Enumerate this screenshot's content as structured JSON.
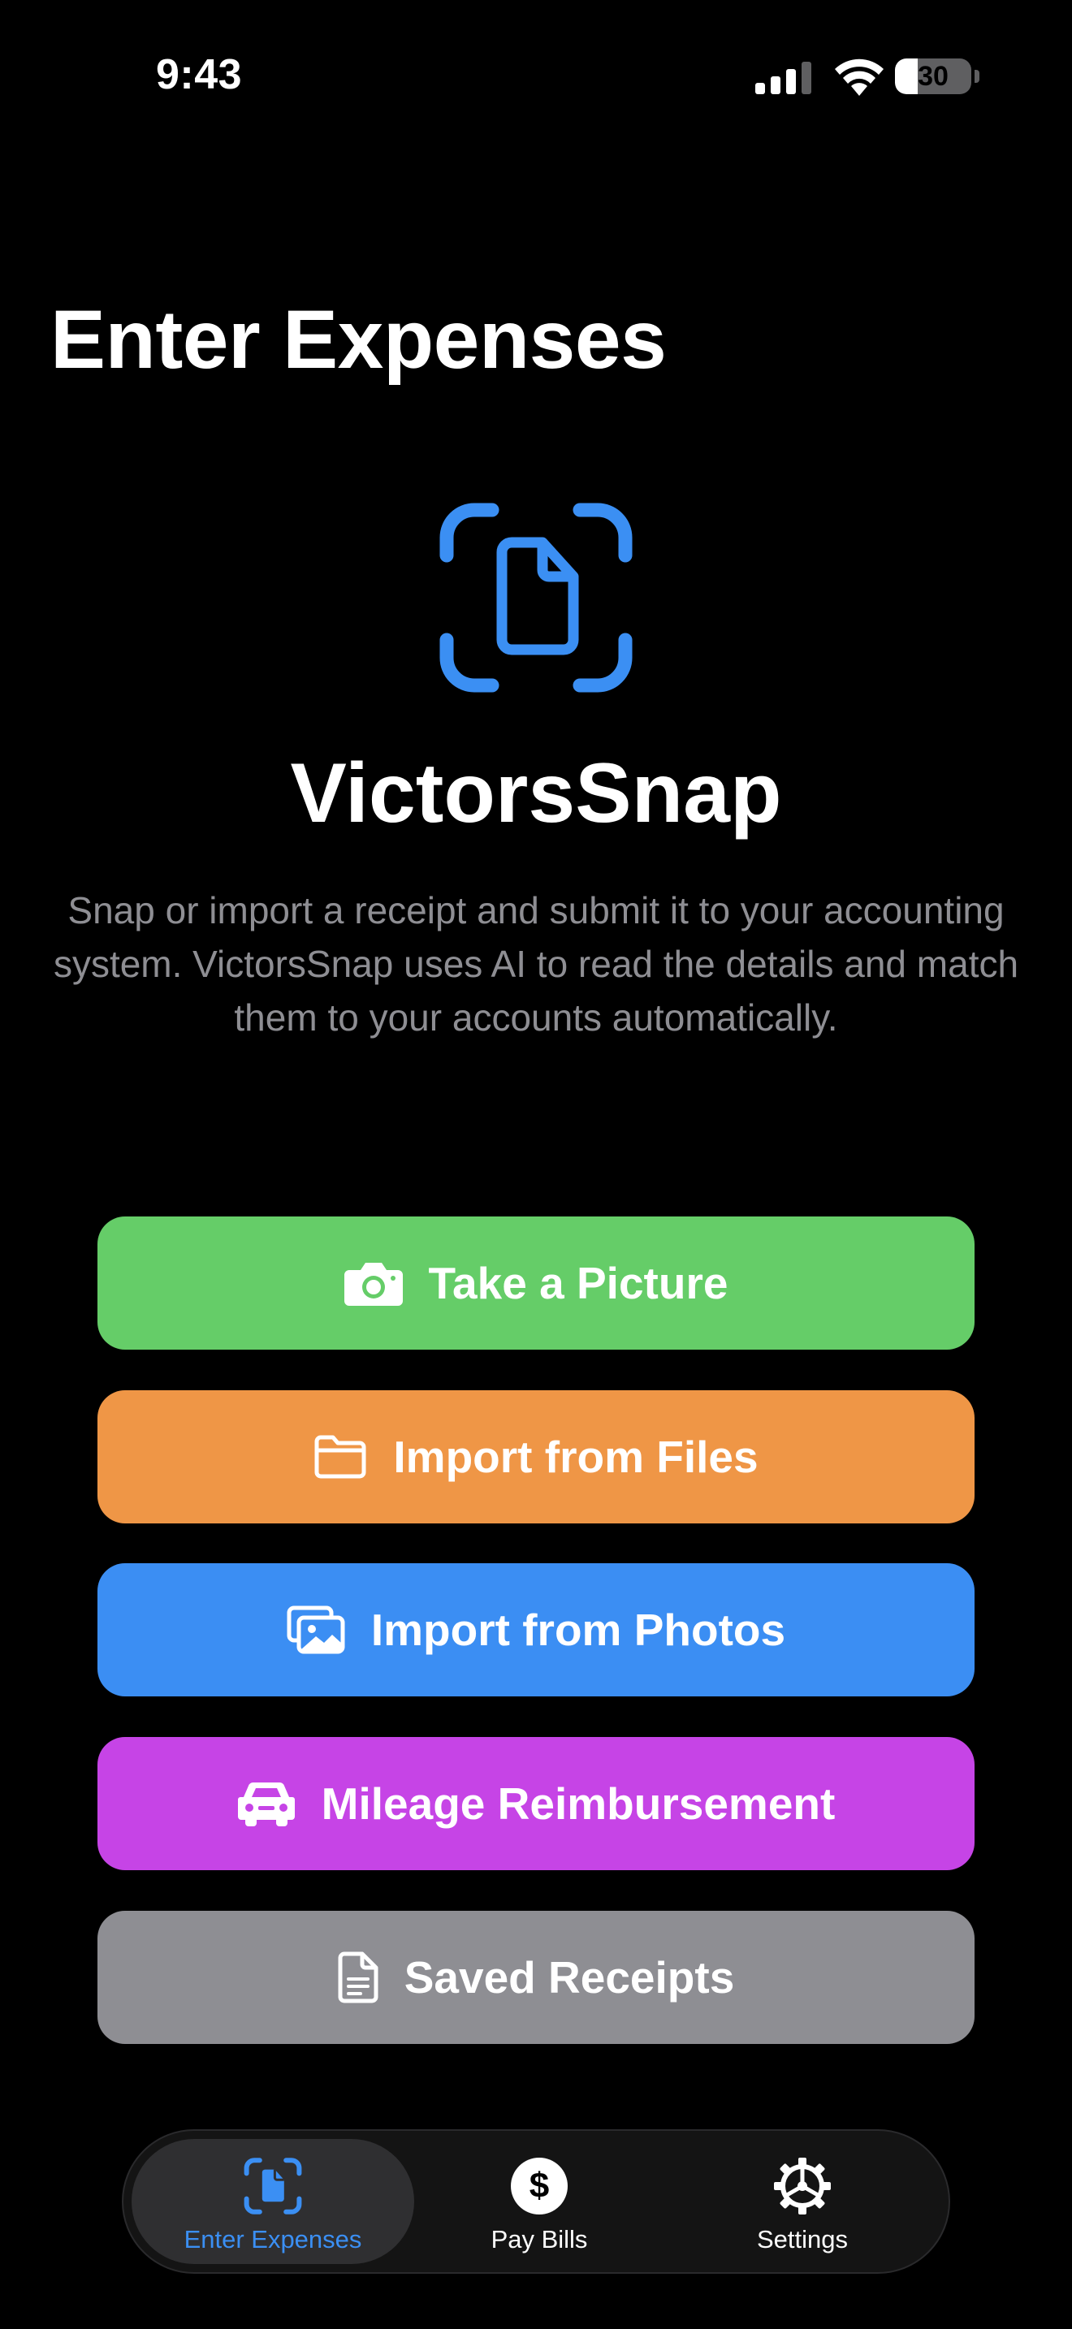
{
  "status_bar": {
    "time": "9:43",
    "battery_level": "30",
    "battery_fraction": 0.3,
    "signal_bars_active": 3,
    "signal_bars_total": 4,
    "icons": [
      "cellular-signal-icon",
      "wifi-icon",
      "battery-icon"
    ]
  },
  "header": {
    "title": "Enter Expenses"
  },
  "hero": {
    "icon": "document-scan-icon",
    "app_name": "VictorsSnap",
    "description": "Snap or import a receipt and submit it to your accounting system. VictorsSnap uses AI to read the details and match them to your accounts automatically."
  },
  "actions": [
    {
      "label": "Take a Picture",
      "icon": "camera-icon",
      "color": "#65cd68"
    },
    {
      "label": "Import from Files",
      "icon": "folder-icon",
      "color": "#ef9646"
    },
    {
      "label": "Import from Photos",
      "icon": "photos-icon",
      "color": "#3b8ef3"
    },
    {
      "label": "Mileage Reimbursement",
      "icon": "car-icon",
      "color": "#c644e6"
    },
    {
      "label": "Saved Receipts",
      "icon": "document-icon",
      "color": "#8e8e93"
    }
  ],
  "tab_bar": {
    "tabs": [
      {
        "label": "Enter Expenses",
        "icon": "document-scan-icon",
        "selected": true
      },
      {
        "label": "Pay Bills",
        "icon": "dollar-circle-icon",
        "selected": false
      },
      {
        "label": "Settings",
        "icon": "gear-icon",
        "selected": false
      }
    ]
  },
  "colors": {
    "background": "#000000",
    "accent": "#3b8ff3",
    "secondary_text": "#8e8e93"
  }
}
